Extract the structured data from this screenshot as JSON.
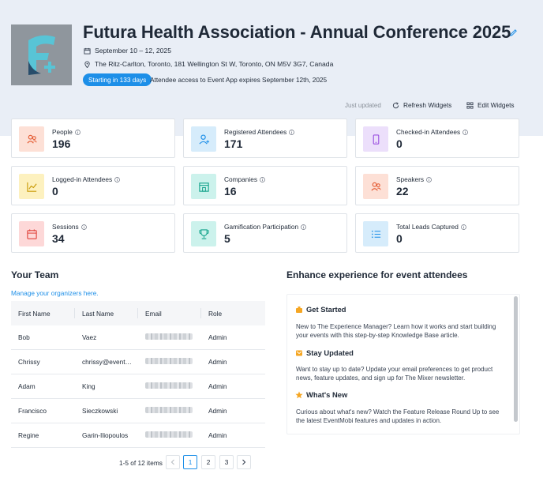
{
  "event": {
    "title": "Futura Health Association - Annual Conference 2025",
    "dates": "September 10 – 12, 2025",
    "location": "The Ritz-Carlton, Toronto, 181 Wellington St W, Toronto, ON M5V 3G7, Canada",
    "countdown_badge": "Starting in 133 days",
    "access_note": "Attendee access to Event App expires September 12th, 2025"
  },
  "toolbar": {
    "status": "Just updated",
    "refresh_label": "Refresh Widgets",
    "edit_label": "Edit Widgets"
  },
  "widgets": [
    {
      "label": "People",
      "value": "196",
      "icon": "people-icon",
      "color": "#fde0d6"
    },
    {
      "label": "Registered Attendees",
      "value": "171",
      "icon": "user-add-icon",
      "color": "#d6ecfb"
    },
    {
      "label": "Checked-in Attendees",
      "value": "0",
      "icon": "mobile-icon",
      "color": "#ecdffb"
    },
    {
      "label": "Logged-in Attendees",
      "value": "0",
      "icon": "chart-icon",
      "color": "#fdf1bf"
    },
    {
      "label": "Companies",
      "value": "16",
      "icon": "building-icon",
      "color": "#ccf2ec"
    },
    {
      "label": "Speakers",
      "value": "22",
      "icon": "speaker-icon",
      "color": "#fde0d6"
    },
    {
      "label": "Sessions",
      "value": "34",
      "icon": "calendar-icon",
      "color": "#fdd8d8"
    },
    {
      "label": "Gamification Participation",
      "value": "5",
      "icon": "trophy-icon",
      "color": "#ccf2ec"
    },
    {
      "label": "Total Leads Captured",
      "value": "0",
      "icon": "list-icon",
      "color": "#d6ecfb"
    }
  ],
  "team": {
    "title": "Your Team",
    "manage_link": "Manage your organizers here.",
    "columns": [
      "First Name",
      "Last Name",
      "Email",
      "Role"
    ],
    "rows": [
      {
        "first": "Bob",
        "last": "Vaez",
        "email": "",
        "role": "Admin"
      },
      {
        "first": "Chrissy",
        "last": "chrissy@event…",
        "email": "",
        "role": "Admin"
      },
      {
        "first": "Adam",
        "last": "King",
        "email": "",
        "role": "Admin"
      },
      {
        "first": "Francisco",
        "last": "Sieczkowski",
        "email": "",
        "role": "Admin"
      },
      {
        "first": "Regine",
        "last": "Garin-Iliopoulos",
        "email": "",
        "role": "Admin"
      }
    ],
    "pagination": {
      "summary": "1-5 of 12 items",
      "pages": [
        "1",
        "2",
        "3"
      ],
      "current": "1"
    }
  },
  "enhance": {
    "title": "Enhance experience for event attendees",
    "items": [
      {
        "heading": "Get Started",
        "icon": "rocket-icon",
        "body": "New to The Experience Manager? Learn how it works and start building your events with this step-by-step Knowledge Base article."
      },
      {
        "heading": "Stay Updated",
        "icon": "mail-icon",
        "body": "Want to stay up to date? Update your email preferences to get product news, feature updates, and sign up for The Mixer newsletter."
      },
      {
        "heading": "What's New",
        "icon": "star-icon",
        "body": "Curious about what's new? Watch the Feature Release Round Up to see the latest EventMobi features and updates in action."
      }
    ]
  },
  "colors": {
    "accent": "#1d8fe8",
    "header_band": "#e9eef6"
  }
}
